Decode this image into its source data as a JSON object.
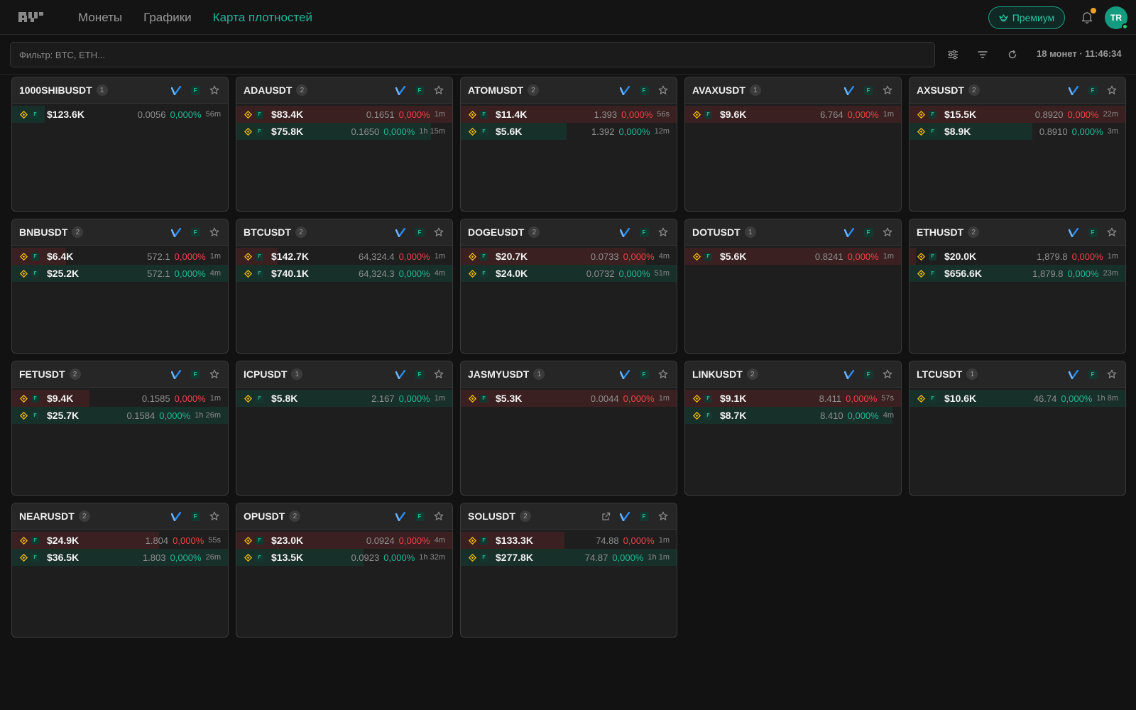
{
  "header": {
    "nav": [
      "Монеты",
      "Графики",
      "Карта плотностей"
    ],
    "active_nav": 2,
    "premium_label": "Премиум",
    "avatar_initials": "TR",
    "accent_color": "#22b397"
  },
  "toolbar": {
    "filter_placeholder": "Фильтр: BTC, ETH...",
    "status": "18 монет · 11:46:34"
  },
  "colors": {
    "ask": "#f0424a",
    "bid": "#20b895"
  },
  "cards": [
    {
      "symbol": "1000SHIBUSDT",
      "count": "1",
      "rows": [
        {
          "side": "bid",
          "volume": "$123.6K",
          "price": "0.0056",
          "pct": "0,000%",
          "age": "56m",
          "fill": 0.15
        }
      ]
    },
    {
      "symbol": "ADAUSDT",
      "count": "2",
      "rows": [
        {
          "side": "ask",
          "volume": "$83.4K",
          "price": "0.1651",
          "pct": "0,000%",
          "age": "1m",
          "fill": 1.0
        },
        {
          "side": "bid",
          "volume": "$75.8K",
          "price": "0.1650",
          "pct": "0,000%",
          "age": "1h 15m",
          "fill": 0.9
        }
      ]
    },
    {
      "symbol": "ATOMUSDT",
      "count": "2",
      "rows": [
        {
          "side": "ask",
          "volume": "$11.4K",
          "price": "1.393",
          "pct": "0,000%",
          "age": "56s",
          "fill": 1.0
        },
        {
          "side": "bid",
          "volume": "$5.6K",
          "price": "1.392",
          "pct": "0,000%",
          "age": "12m",
          "fill": 0.49
        }
      ]
    },
    {
      "symbol": "AVAXUSDT",
      "count": "1",
      "rows": [
        {
          "side": "ask",
          "volume": "$9.6K",
          "price": "6.764",
          "pct": "0,000%",
          "age": "1m",
          "fill": 1.0
        }
      ]
    },
    {
      "symbol": "AXSUSDT",
      "count": "2",
      "rows": [
        {
          "side": "ask",
          "volume": "$15.5K",
          "price": "0.8920",
          "pct": "0,000%",
          "age": "22m",
          "fill": 1.0
        },
        {
          "side": "bid",
          "volume": "$8.9K",
          "price": "0.8910",
          "pct": "0,000%",
          "age": "3m",
          "fill": 0.57
        }
      ]
    },
    {
      "symbol": "BNBUSDT",
      "count": "2",
      "rows": [
        {
          "side": "ask",
          "volume": "$6.4K",
          "price": "572.1",
          "pct": "0,000%",
          "age": "1m",
          "fill": 0.25
        },
        {
          "side": "bid",
          "volume": "$25.2K",
          "price": "572.1",
          "pct": "0,000%",
          "age": "4m",
          "fill": 1.0
        }
      ]
    },
    {
      "symbol": "BTCUSDT",
      "count": "2",
      "rows": [
        {
          "side": "ask",
          "volume": "$142.7K",
          "price": "64,324.4",
          "pct": "0,000%",
          "age": "1m",
          "fill": 0.19
        },
        {
          "side": "bid",
          "volume": "$740.1K",
          "price": "64,324.3",
          "pct": "0,000%",
          "age": "4m",
          "fill": 1.0
        }
      ]
    },
    {
      "symbol": "DOGEUSDT",
      "count": "2",
      "rows": [
        {
          "side": "ask",
          "volume": "$20.7K",
          "price": "0.0733",
          "pct": "0,000%",
          "age": "4m",
          "fill": 0.86
        },
        {
          "side": "bid",
          "volume": "$24.0K",
          "price": "0.0732",
          "pct": "0,000%",
          "age": "51m",
          "fill": 1.0
        }
      ]
    },
    {
      "symbol": "DOTUSDT",
      "count": "1",
      "rows": [
        {
          "side": "ask",
          "volume": "$5.6K",
          "price": "0.8241",
          "pct": "0,000%",
          "age": "1m",
          "fill": 1.0
        }
      ]
    },
    {
      "symbol": "ETHUSDT",
      "count": "2",
      "rows": [
        {
          "side": "ask",
          "volume": "$20.0K",
          "price": "1,879.8",
          "pct": "0,000%",
          "age": "1m",
          "fill": 0.03
        },
        {
          "side": "bid",
          "volume": "$656.6K",
          "price": "1,879.8",
          "pct": "0,000%",
          "age": "23m",
          "fill": 1.0
        }
      ]
    },
    {
      "symbol": "FETUSDT",
      "count": "2",
      "rows": [
        {
          "side": "ask",
          "volume": "$9.4K",
          "price": "0.1585",
          "pct": "0,000%",
          "age": "1m",
          "fill": 0.36
        },
        {
          "side": "bid",
          "volume": "$25.7K",
          "price": "0.1584",
          "pct": "0,000%",
          "age": "1h 26m",
          "fill": 1.0
        }
      ]
    },
    {
      "symbol": "ICPUSDT",
      "count": "1",
      "rows": [
        {
          "side": "bid",
          "volume": "$5.8K",
          "price": "2.167",
          "pct": "0,000%",
          "age": "1m",
          "fill": 1.0
        }
      ]
    },
    {
      "symbol": "JASMYUSDT",
      "count": "1",
      "rows": [
        {
          "side": "ask",
          "volume": "$5.3K",
          "price": "0.0044",
          "pct": "0,000%",
          "age": "1m",
          "fill": 1.0
        }
      ]
    },
    {
      "symbol": "LINKUSDT",
      "count": "2",
      "rows": [
        {
          "side": "ask",
          "volume": "$9.1K",
          "price": "8.411",
          "pct": "0,000%",
          "age": "57s",
          "fill": 1.0
        },
        {
          "side": "bid",
          "volume": "$8.7K",
          "price": "8.410",
          "pct": "0,000%",
          "age": "4m",
          "fill": 0.96
        }
      ]
    },
    {
      "symbol": "LTCUSDT",
      "count": "1",
      "rows": [
        {
          "side": "bid",
          "volume": "$10.6K",
          "price": "46.74",
          "pct": "0,000%",
          "age": "1h 8m",
          "fill": 1.0
        }
      ]
    },
    {
      "symbol": "NEARUSDT",
      "count": "2",
      "rows": [
        {
          "side": "ask",
          "volume": "$24.9K",
          "price": "1.804",
          "pct": "0,000%",
          "age": "55s",
          "fill": 0.68
        },
        {
          "side": "bid",
          "volume": "$36.5K",
          "price": "1.803",
          "pct": "0,000%",
          "age": "26m",
          "fill": 1.0
        }
      ]
    },
    {
      "symbol": "OPUSDT",
      "count": "2",
      "rows": [
        {
          "side": "ask",
          "volume": "$23.0K",
          "price": "0.0924",
          "pct": "0,000%",
          "age": "4m",
          "fill": 1.0
        },
        {
          "side": "bid",
          "volume": "$13.5K",
          "price": "0.0923",
          "pct": "0,000%",
          "age": "1h 32m",
          "fill": 0.59
        }
      ]
    },
    {
      "symbol": "SOLUSDT",
      "count": "2",
      "external": true,
      "rows": [
        {
          "side": "ask",
          "volume": "$133.3K",
          "price": "74.88",
          "pct": "0,000%",
          "age": "1m",
          "fill": 0.48
        },
        {
          "side": "bid",
          "volume": "$277.8K",
          "price": "74.87",
          "pct": "0,000%",
          "age": "1h 1m",
          "fill": 1.0
        }
      ]
    }
  ]
}
